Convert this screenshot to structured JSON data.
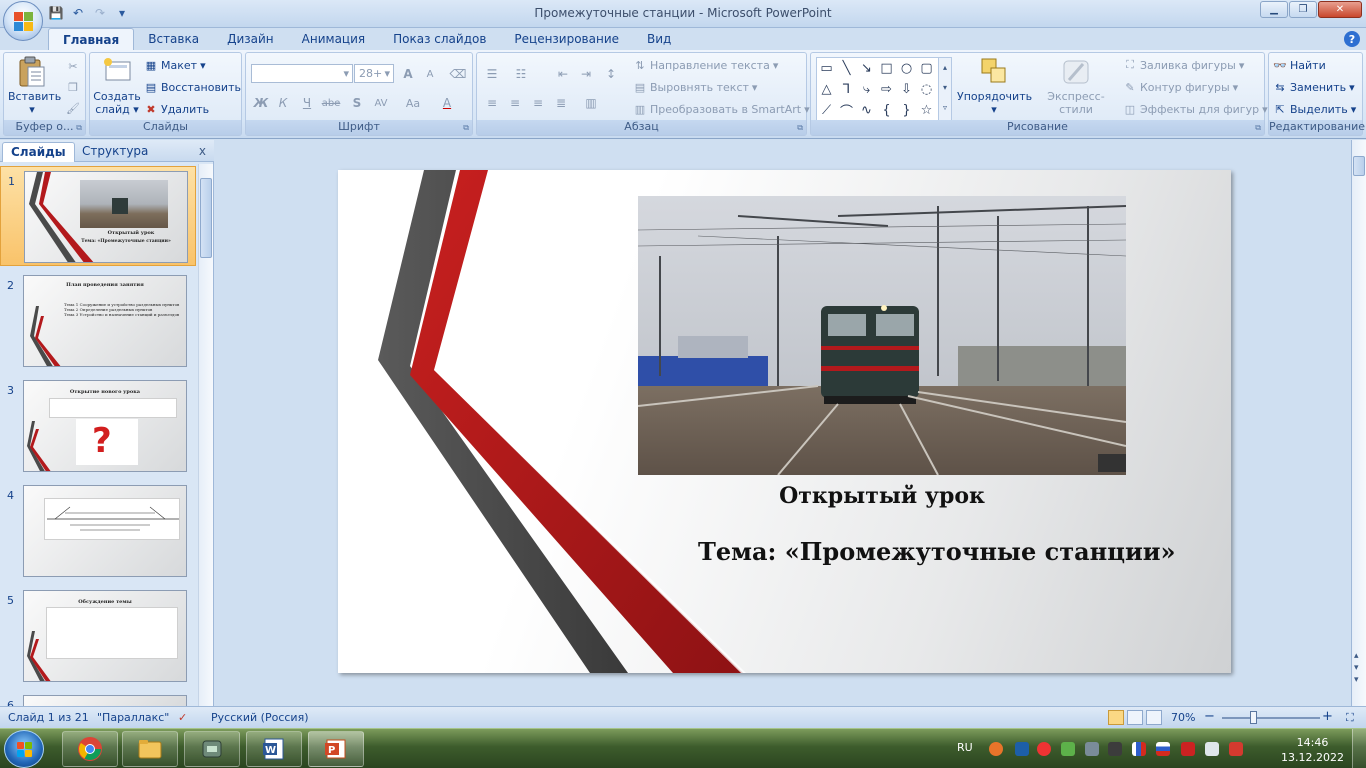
{
  "window": {
    "title": "Промежуточные станции - Microsoft PowerPoint",
    "minimize_glyph": "▁",
    "maximize_glyph": "❐",
    "close_glyph": "✕"
  },
  "quick_access": {
    "save_glyph": "💾",
    "undo_glyph": "↶",
    "redo_glyph": "↷",
    "more_glyph": "▾"
  },
  "ribbon_tabs": [
    {
      "label": "Главная",
      "active": true
    },
    {
      "label": "Вставка"
    },
    {
      "label": "Дизайн"
    },
    {
      "label": "Анимация"
    },
    {
      "label": "Показ слайдов"
    },
    {
      "label": "Рецензирование"
    },
    {
      "label": "Вид"
    }
  ],
  "help_glyph": "?",
  "groups": {
    "clipboard": {
      "label": "Буфер о...",
      "paste": "Вставить"
    },
    "slides": {
      "label": "Слайды",
      "new_slide_line1": "Создать",
      "new_slide_line2": "слайд",
      "layout": "Макет",
      "reset": "Восстановить",
      "delete": "Удалить"
    },
    "font": {
      "label": "Шрифт",
      "font_name": "",
      "font_size": "28+"
    },
    "paragraph": {
      "label": "Абзац",
      "text_direction": "Направление текста",
      "align_text": "Выровнять текст",
      "convert_smartart": "Преобразовать в SmartArt"
    },
    "drawing": {
      "label": "Рисование",
      "arrange": "Упорядочить",
      "quick_styles": "Экспресс-стили",
      "shape_fill": "Заливка фигуры",
      "shape_outline": "Контур фигуры",
      "shape_effects": "Эффекты для фигур"
    },
    "editing": {
      "label": "Редактирование",
      "find": "Найти",
      "replace": "Заменить",
      "select": "Выделить"
    }
  },
  "format_buttons": {
    "bold": "Ж",
    "italic": "К",
    "underline": "Ч",
    "strike": "abe",
    "shadow": "S",
    "spacing": "AV",
    "case": "Aa",
    "color": "A",
    "grow": "A",
    "shrink": "A"
  },
  "left_pane": {
    "tab_slides": "Слайды",
    "tab_outline": "Структура",
    "close_glyph": "x",
    "thumbnails": [
      {
        "num": "1",
        "title": "Открытый урок",
        "subtitle": "Тема: «Промежуточные станции»"
      },
      {
        "num": "2",
        "title": "План проведения занятия",
        "lines": [
          "Тема 1 Сооружение и устройство раздельных пунктов",
          "Тема 2 Определение раздельных пунктов",
          "Тема 3 Устройство и назначение станций и разъездов"
        ]
      },
      {
        "num": "3",
        "title": "Открытие нового урока"
      },
      {
        "num": "4"
      },
      {
        "num": "5",
        "title": "Обсуждение темы"
      },
      {
        "num": "6"
      }
    ]
  },
  "slide": {
    "title": "Открытый урок",
    "subtitle": "Тема: «Промежуточные станции»"
  },
  "statusbar": {
    "slide_info": "Слайд 1 из 21",
    "theme": "\"Параллакс\"",
    "language": "Русский (Россия)",
    "zoom": "70%",
    "zoom_minus": "−",
    "zoom_plus": "+"
  },
  "taskbar": {
    "lang": "RU",
    "time": "14:46",
    "date": "13.12.2022"
  },
  "colors": {
    "accent_red": "#b3191c",
    "dark_gray": "#4a4a4a",
    "ribbon_blue": "#15428b"
  }
}
